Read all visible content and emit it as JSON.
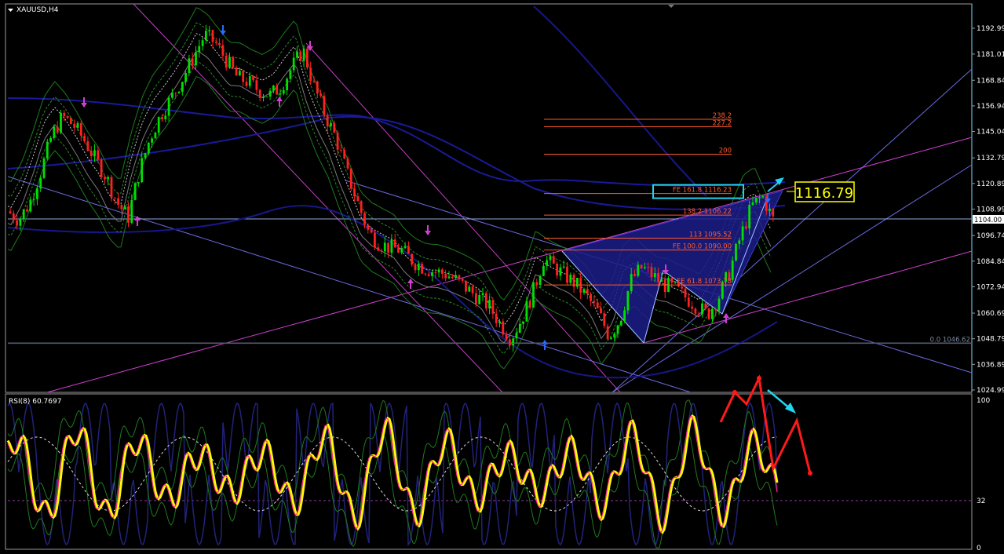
{
  "chart_data": [
    {
      "type": "candlestick",
      "title": "XAUUSD,H4",
      "symbol": "XAUUSD",
      "timeframe": "H4",
      "ylim": [
        1021,
        1199
      ],
      "y_ticks": [
        1192.99,
        1181.01,
        1168.84,
        1156.94,
        1145.04,
        1132.79,
        1120.89,
        1108.99,
        1096.74,
        1084.84,
        1072.94,
        1060.69,
        1048.79,
        1036.89,
        1024.99
      ],
      "current_price": "1104.00",
      "price_callout": "1116.79",
      "fibo_levels": [
        {
          "label": "238.2",
          "price": 1150.7
        },
        {
          "label": "227.2",
          "price": 1147.3
        },
        {
          "label": "200",
          "price": 1134.5
        },
        {
          "label": "FE 161.8 1116.23",
          "price": 1116.23,
          "boxed": true
        },
        {
          "label": "138.2 1106.22",
          "price": 1106.22
        },
        {
          "label": "113 1095.52",
          "price": 1095.52
        },
        {
          "label": "FE 100.0 1090.00",
          "price": 1090.0
        },
        {
          "label": "FE 61.8 1073.78",
          "price": 1073.78
        },
        {
          "label": "0.0 1046.62",
          "price": 1046.62
        }
      ],
      "price_path": [
        1108,
        1104,
        1112,
        1126,
        1143,
        1152,
        1148,
        1141,
        1132,
        1124,
        1112,
        1105,
        1126,
        1142,
        1153,
        1161,
        1170,
        1180,
        1190,
        1186,
        1178,
        1170,
        1168,
        1164,
        1162,
        1166,
        1175,
        1183,
        1166,
        1153,
        1142,
        1126,
        1112,
        1098,
        1093,
        1091,
        1090,
        1085,
        1082,
        1080,
        1079,
        1076,
        1072,
        1068,
        1064,
        1056,
        1049,
        1058,
        1070,
        1086,
        1082,
        1078,
        1074,
        1068,
        1061,
        1050,
        1058,
        1076,
        1082,
        1078,
        1074,
        1072,
        1068,
        1064,
        1060,
        1068,
        1080,
        1096,
        1110,
        1115,
        1104
      ]
    },
    {
      "type": "line",
      "title": "RSI(8) 60.7697",
      "ylim": [
        0,
        100
      ],
      "y_ticks": [
        100,
        32,
        0
      ],
      "level": 32
    }
  ]
}
